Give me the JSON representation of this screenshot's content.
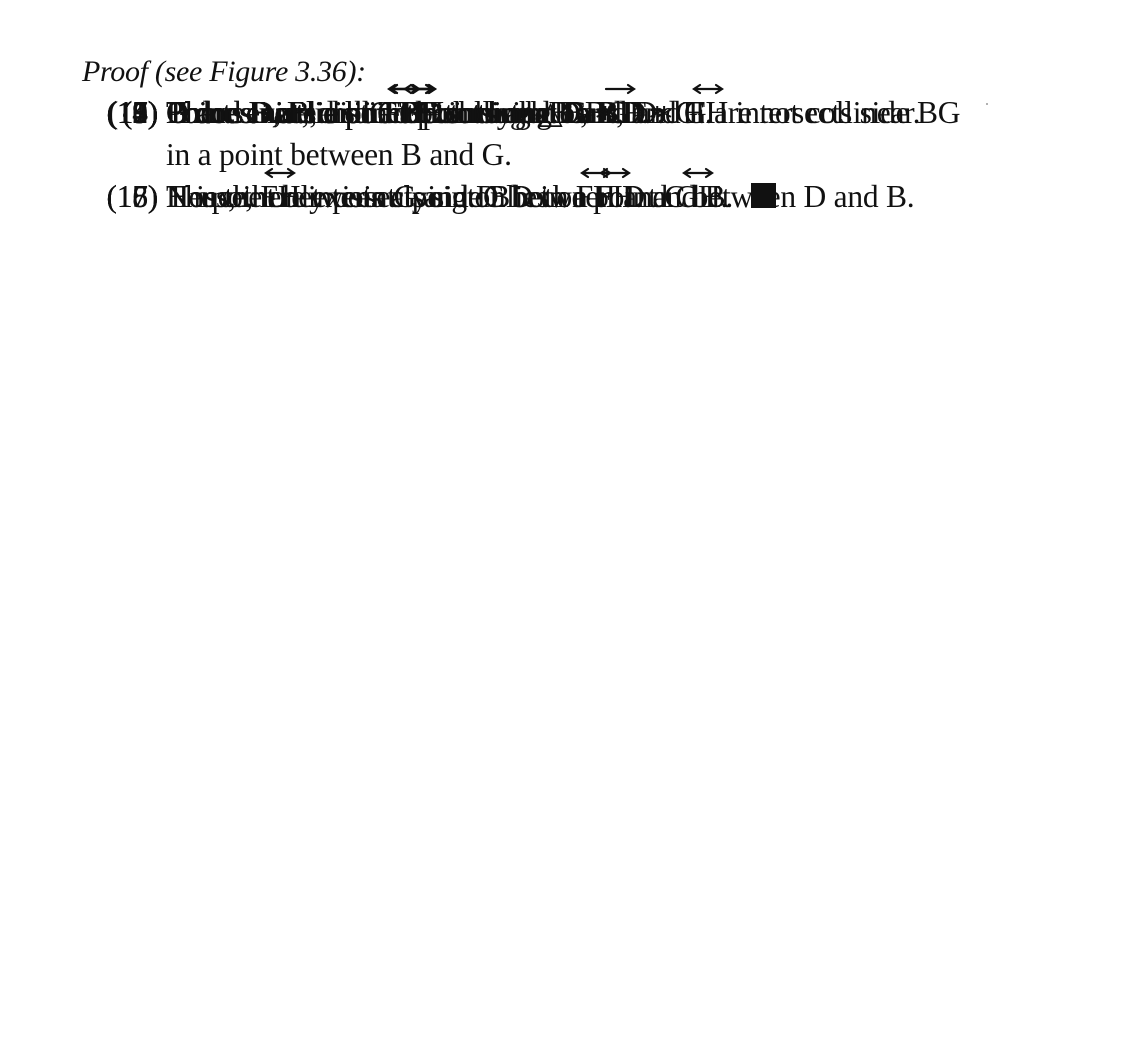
{
  "title": "Proof (see Figure 3.36):",
  "steps": [
    {
      "num": "(1)",
      "lines": [
        [
          {
            "t": "There exists a line "
          },
          {
            "s": "BD",
            "a": "ray"
          },
          {
            "t": " through B and D."
          }
        ]
      ]
    },
    {
      "num": "(2)",
      "lines": [
        [
          {
            "t": "There exists a point F not lying on "
          },
          {
            "s": "BD",
            "a": "ray"
          },
          {
            "t": "."
          }
        ]
      ]
    },
    {
      "num": "(3)",
      "lines": [
        [
          {
            "t": "There exists a line "
          },
          {
            "s": "BF",
            "a": "ray"
          },
          {
            "t": " through B and F."
          }
        ]
      ]
    },
    {
      "num": "(4)",
      "lines": [
        [
          {
            "t": "There exists a point G such that B ∗ F ∗ G."
          }
        ]
      ]
    },
    {
      "num": "(5)",
      "lines": [
        [
          {
            "t": "Points B, F, and G are collinear."
          }
        ]
      ]
    },
    {
      "num": "(6)",
      "lines": [
        [
          {
            "t": "G and D are distinct points and D, B, and G are not collinear."
          }
        ]
      ]
    },
    {
      "num": "(7)",
      "lines": [
        [
          {
            "t": "There exists a point H such that G ∗ D ∗ H."
          }
        ]
      ]
    },
    {
      "num": "(8)",
      "lines": [
        [
          {
            "t": "There exists a line "
          },
          {
            "s": "GH",
            "a": "ray"
          },
          {
            "t": "."
          }
        ]
      ]
    },
    {
      "num": "(9)",
      "lines": [
        [
          {
            "t": "H and F are distinct points."
          }
        ]
      ]
    },
    {
      "num": "(10)",
      "lines": [
        [
          {
            "t": "There exists a line "
          },
          {
            "s": "FH",
            "a": "line"
          },
          {
            "t": "."
          }
        ]
      ]
    },
    {
      "num": "(11)",
      "lines": [
        [
          {
            "t": "D does not lie on "
          },
          {
            "s": "FH",
            "a": "line"
          },
          {
            "t": "."
          }
        ]
      ]
    },
    {
      "num": "(12)",
      "lines": [
        [
          {
            "t": "B does not lie on "
          },
          {
            "s": "FH",
            "a": "line"
          },
          {
            "t": "."
          }
        ]
      ]
    },
    {
      "num": "(13)",
      "lines": [
        [
          {
            "t": "G does not lie on "
          },
          {
            "s": "FH",
            "a": "line"
          },
          {
            "t": "."
          }
        ]
      ]
    },
    {
      "num": "(14)",
      "lines": [
        [
          {
            "t": "Points D, B, and G determine △DBG and "
          },
          {
            "s": "FH",
            "a": "line"
          },
          {
            "t": " intersects side BG"
          }
        ],
        [
          {
            "t": "in a point between B and G."
          }
        ]
      ]
    },
    {
      "num": "(15)",
      "lines": [
        [
          {
            "t": "H is the only point lying on both "
          },
          {
            "s": "FH",
            "a": "line"
          },
          {
            "t": " and "
          },
          {
            "s": "GH",
            "a": "line"
          },
          {
            "t": "."
          }
        ]
      ]
    },
    {
      "num": "(16)",
      "lines": [
        [
          {
            "t": "No point between G and D lies on "
          },
          {
            "s": "FH",
            "a": "line"
          },
          {
            "t": "."
          }
        ]
      ]
    },
    {
      "num": "(17)",
      "lines": [
        [
          {
            "t": "Hence, "
          },
          {
            "s": "FH",
            "a": "line"
          },
          {
            "t": " intersects side BD in a point C between D and B."
          }
        ]
      ]
    },
    {
      "num": "(18)",
      "lines": [
        [
          {
            "t": "Thus, there exists a point C between D and B."
          },
          {
            "qed": "end-of-proof-square"
          }
        ]
      ]
    }
  ]
}
